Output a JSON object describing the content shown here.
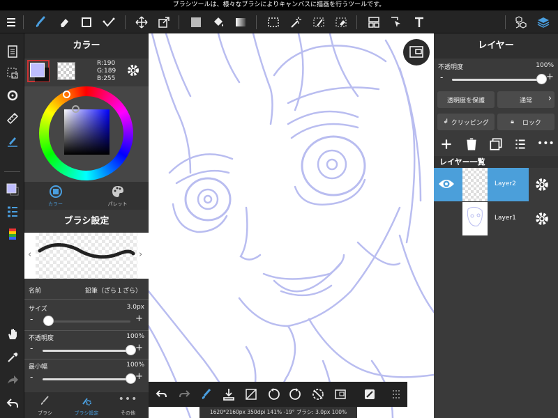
{
  "status_message": "ブラシツールは、様々なブラシによりキャンバスに描画を行うツールです。",
  "colors": {
    "accent": "#4a9fe0",
    "layer_selected": "#4b9fda",
    "stroke": "#b9bdf0",
    "current_color": "#bebdff"
  },
  "color_panel": {
    "title": "カラー",
    "r": "R:190",
    "g": "G:189",
    "b": "B:255",
    "tabs": [
      {
        "label": "カラー"
      },
      {
        "label": "パレット"
      }
    ]
  },
  "brush_panel": {
    "title": "ブラシ設定",
    "name_label": "名前",
    "name_value": "鉛筆（ざら１ざら）",
    "size_label": "サイズ",
    "size_value": "3.0px",
    "size_level": 0.06,
    "opacity_label": "不透明度",
    "opacity_value": "100%",
    "opacity_level": 1.0,
    "minwidth_label": "最小幅",
    "minwidth_value": "100%",
    "minwidth_level": 1.0,
    "minus": "-",
    "plus": "+"
  },
  "bottom_tabs": [
    {
      "label": "ブラシ"
    },
    {
      "label": "ブラシ設定"
    },
    {
      "label": "その他"
    }
  ],
  "layer_panel": {
    "title": "レイヤー",
    "opacity_label": "不透明度",
    "opacity_value": "100%",
    "opacity_level": 1.0,
    "minus": "-",
    "plus": "+",
    "protect_label": "透明度を保護",
    "blend_label": "通常",
    "clipping_label": "クリッピング",
    "lock_label": "ロック",
    "list_title": "レイヤー一覧",
    "layers": [
      {
        "name": "Layer2"
      },
      {
        "name": "Layer1"
      }
    ]
  },
  "canvas_info": "1620*2160px 350dpi 141% -19° ブラシ: 3.0px 100%",
  "icons": {
    "menu": "menu-icon",
    "brush": "brush-icon",
    "eraser": "eraser-icon",
    "select": "select-rect-icon",
    "move": "move-icon",
    "fill": "bucket-icon",
    "text": "text-icon",
    "layers": "layers-icon",
    "undo": "undo-icon",
    "redo": "redo-icon"
  }
}
